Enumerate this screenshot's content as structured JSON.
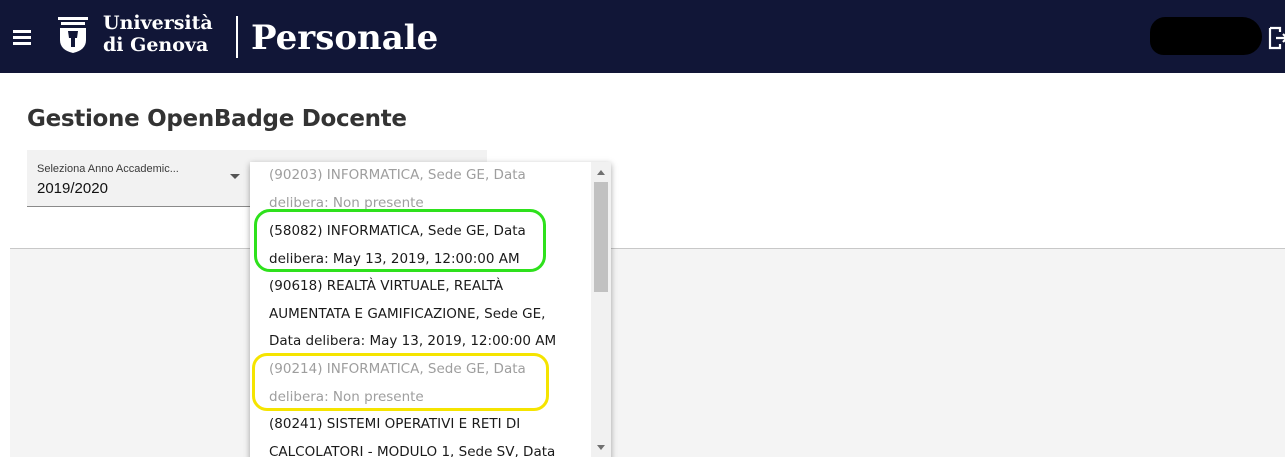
{
  "header": {
    "university_line1": "Università",
    "university_line2": "di Genova",
    "app_title": "Personale",
    "icons": {
      "menu": "hamburger-menu-icon",
      "logo": "university-crest-logo",
      "logout": "logout-icon"
    },
    "background_color": "#111637"
  },
  "page": {
    "title": "Gestione OpenBadge Docente"
  },
  "year_select": {
    "label": "Seleziona Anno Accademic...",
    "value": "2019/2020"
  },
  "dropdown": {
    "options": [
      {
        "line1": "(90203) INFORMATICA, Sede GE, Data",
        "line2": "delibera: Non presente",
        "enabled": false
      },
      {
        "line1": "(58082) INFORMATICA, Sede GE, Data",
        "line2": "delibera: May 13, 2019, 12:00:00 AM",
        "enabled": true
      },
      {
        "line1": "(90618) REALTÀ VIRTUALE, REALTÀ",
        "line2": "AUMENTATA E GAMIFICAZIONE, Sede GE,",
        "line3": "Data delibera: May 13, 2019, 12:00:00 AM",
        "enabled": true
      },
      {
        "line1": "(90214) INFORMATICA, Sede GE, Data",
        "line2": "delibera: Non presente",
        "enabled": false
      },
      {
        "line1": "(80241) SISTEMI OPERATIVI E RETI DI",
        "line2": "CALCOLATORI - MODULO 1, Sede SV, Data",
        "enabled": true
      }
    ]
  },
  "annotations": {
    "green_color": "#2ee11c",
    "yellow_color": "#f5e400"
  }
}
